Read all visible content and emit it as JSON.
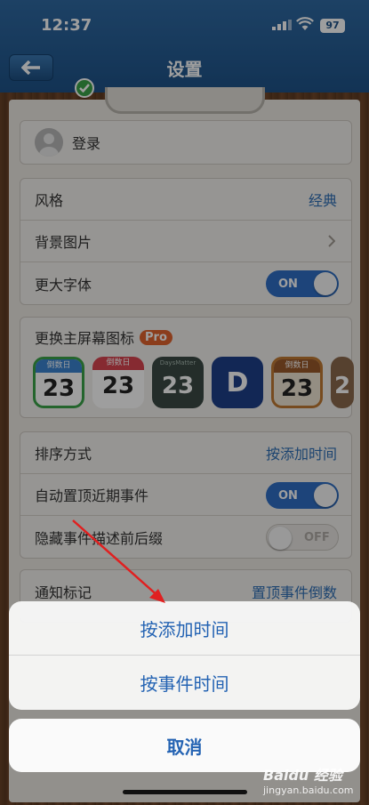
{
  "status_bar": {
    "time": "12:37",
    "battery": "97"
  },
  "nav": {
    "title": "设置"
  },
  "login": {
    "label": "登录"
  },
  "style_group": {
    "rows": [
      {
        "label": "风格",
        "value": "经典"
      },
      {
        "label": "背景图片"
      },
      {
        "label": "更大字体",
        "toggle": "ON"
      }
    ]
  },
  "icon_group": {
    "title": "更换主屏幕图标",
    "pro_badge": "Pro",
    "icons": [
      {
        "top": "倒数日",
        "num": "23"
      },
      {
        "top": "倒数日",
        "num": "23"
      },
      {
        "top": "DaysMatter",
        "num": "23"
      },
      {
        "top": "",
        "num": "D"
      },
      {
        "top": "倒数日",
        "num": "23"
      },
      {
        "top": "",
        "num": "2"
      }
    ]
  },
  "sort_group": {
    "rows": [
      {
        "label": "排序方式",
        "value": "按添加时间"
      },
      {
        "label": "自动置顶近期事件",
        "toggle": "ON"
      },
      {
        "label": "隐藏事件描述前后缀",
        "toggle": "OFF"
      }
    ]
  },
  "notify_group": {
    "label": "通知标记",
    "value": "置顶事件倒数"
  },
  "action_sheet": {
    "options": [
      "按添加时间",
      "按事件时间"
    ],
    "cancel": "取消"
  },
  "watermark": {
    "logo": "Baidu 经验",
    "url": "jingyan.baidu.com"
  },
  "colors": {
    "accent": "#2e6fb5",
    "header": "#1e5288",
    "toggle_on": "#2f6fc5",
    "pro": "#e0632e"
  }
}
